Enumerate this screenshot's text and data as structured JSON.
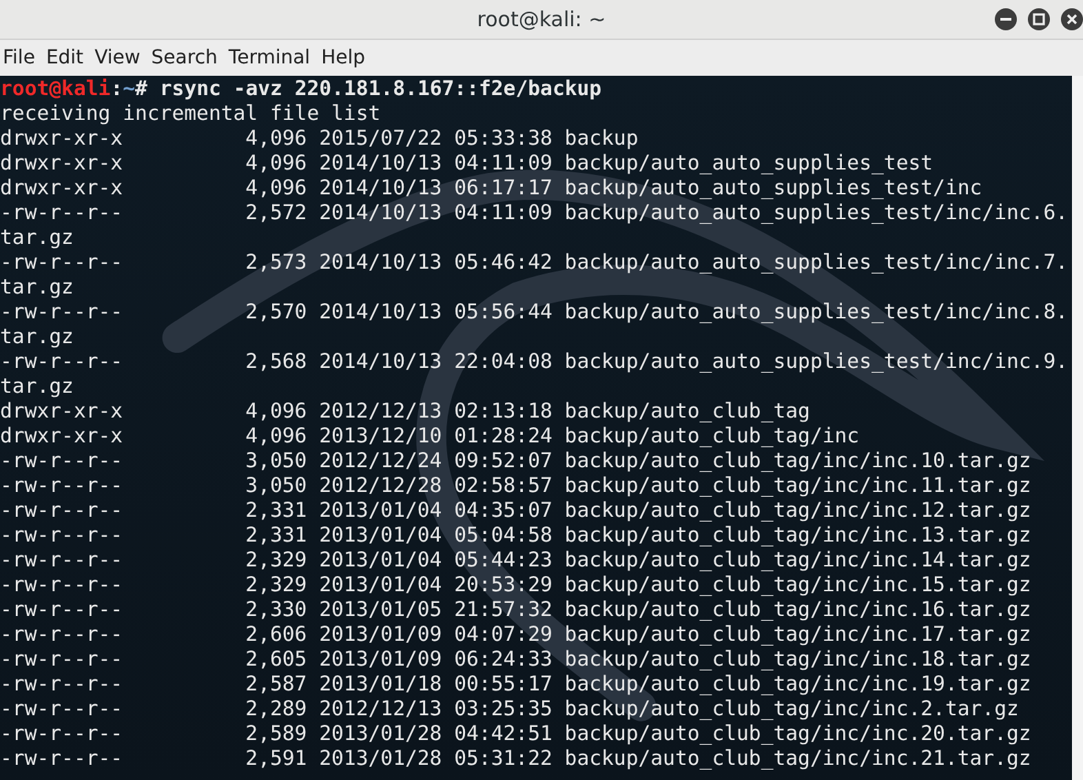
{
  "window": {
    "title": "root@kali: ~"
  },
  "menu": [
    "File",
    "Edit",
    "View",
    "Search",
    "Terminal",
    "Help"
  ],
  "prompt": {
    "user_host": "root@kali",
    "separator": ":",
    "cwd": "~",
    "symbol": "#",
    "command": "rsync -avz 220.181.8.167::f2e/backup"
  },
  "lines": [
    "receiving incremental file list",
    "drwxr-xr-x          4,096 2015/07/22 05:33:38 backup",
    "drwxr-xr-x          4,096 2014/10/13 04:11:09 backup/auto_auto_supplies_test",
    "drwxr-xr-x          4,096 2014/10/13 06:17:17 backup/auto_auto_supplies_test/inc",
    "-rw-r--r--          2,572 2014/10/13 04:11:09 backup/auto_auto_supplies_test/inc/inc.6.",
    "tar.gz",
    "-rw-r--r--          2,573 2014/10/13 05:46:42 backup/auto_auto_supplies_test/inc/inc.7.",
    "tar.gz",
    "-rw-r--r--          2,570 2014/10/13 05:56:44 backup/auto_auto_supplies_test/inc/inc.8.",
    "tar.gz",
    "-rw-r--r--          2,568 2014/10/13 22:04:08 backup/auto_auto_supplies_test/inc/inc.9.",
    "tar.gz",
    "drwxr-xr-x          4,096 2012/12/13 02:13:18 backup/auto_club_tag",
    "drwxr-xr-x          4,096 2013/12/10 01:28:24 backup/auto_club_tag/inc",
    "-rw-r--r--          3,050 2012/12/24 09:52:07 backup/auto_club_tag/inc/inc.10.tar.gz",
    "-rw-r--r--          3,050 2012/12/28 02:58:57 backup/auto_club_tag/inc/inc.11.tar.gz",
    "-rw-r--r--          2,331 2013/01/04 04:35:07 backup/auto_club_tag/inc/inc.12.tar.gz",
    "-rw-r--r--          2,331 2013/01/04 05:04:58 backup/auto_club_tag/inc/inc.13.tar.gz",
    "-rw-r--r--          2,329 2013/01/04 05:44:23 backup/auto_club_tag/inc/inc.14.tar.gz",
    "-rw-r--r--          2,329 2013/01/04 20:53:29 backup/auto_club_tag/inc/inc.15.tar.gz",
    "-rw-r--r--          2,330 2013/01/05 21:57:32 backup/auto_club_tag/inc/inc.16.tar.gz",
    "-rw-r--r--          2,606 2013/01/09 04:07:29 backup/auto_club_tag/inc/inc.17.tar.gz",
    "-rw-r--r--          2,605 2013/01/09 06:24:33 backup/auto_club_tag/inc/inc.18.tar.gz",
    "-rw-r--r--          2,587 2013/01/18 00:55:17 backup/auto_club_tag/inc/inc.19.tar.gz",
    "-rw-r--r--          2,289 2012/12/13 03:25:35 backup/auto_club_tag/inc/inc.2.tar.gz",
    "-rw-r--r--          2,589 2013/01/28 04:42:51 backup/auto_club_tag/inc/inc.20.tar.gz",
    "-rw-r--r--          2,591 2013/01/28 05:31:22 backup/auto_club_tag/inc/inc.21.tar.gz"
  ]
}
